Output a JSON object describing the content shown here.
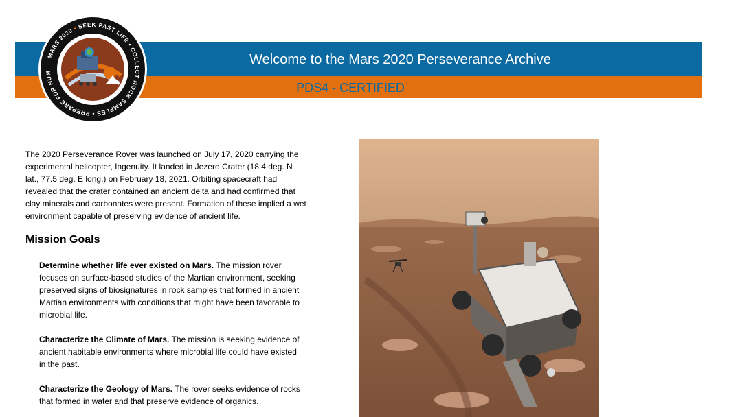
{
  "header": {
    "title": "Welcome to the Mars 2020 Perseverance Archive",
    "subtitle": "PDS4 - CERTIFIED",
    "logo": {
      "top_text": "MARS 2020",
      "ring_text": "SEEK PAST LIFE • COLLECT ROCK SAMPLES • PREPARE FOR HUMANS"
    },
    "colors": {
      "blue": "#0b6aa2",
      "orange": "#e2700f"
    }
  },
  "intro": "The 2020 Perseverance Rover was launched on July 17, 2020 carrying the experimental helicopter, Ingenuity. It landed in Jezero Crater (18.4 deg. N lat., 77.5 deg. E long.) on February 18, 2021. Orbiting spacecraft had revealed that the crater contained an ancient delta and had confirmed that clay minerals and carbonates were present. Formation of these implied a wet environment capable of preserving evidence of ancient life.",
  "mission_goals": {
    "heading": "Mission Goals",
    "items": [
      {
        "title": "Determine whether life ever existed on Mars.",
        "text": " The mission rover focuses on surface-based studies of the Martian environment, seeking preserved signs of biosignatures in rock samples that formed in ancient Martian environments with conditions that might have been favorable to microbial life."
      },
      {
        "title": "Characterize the Climate of Mars.",
        "text": " The mission is seeking evidence of ancient habitable environments where microbial life could have existed in the past."
      },
      {
        "title": "Characterize the Geology of Mars.",
        "text": " The rover seeks evidence of rocks that formed in water and that preserve evidence of organics."
      }
    ]
  }
}
